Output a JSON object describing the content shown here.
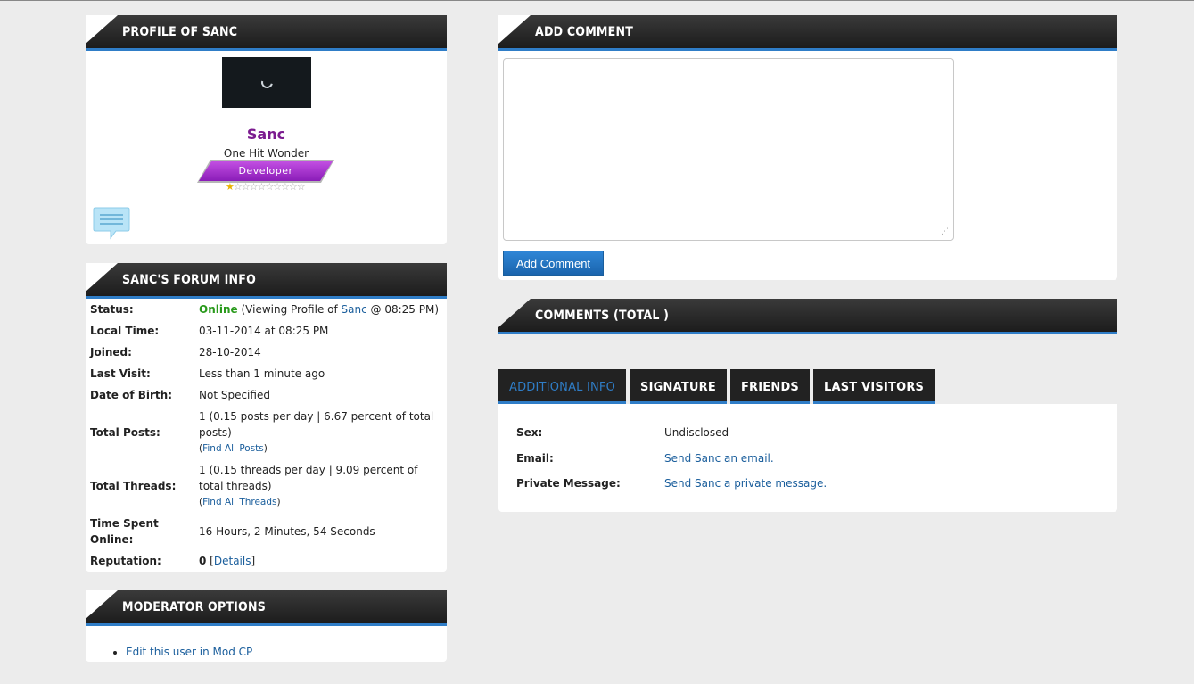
{
  "profile": {
    "header": "PROFILE OF SANC",
    "username": "Sanc",
    "user_title": "One Hit Wonder",
    "rank": "Developer",
    "stars_filled": 1,
    "stars_total": 10
  },
  "forum_info": {
    "header": "SANC'S FORUM INFO",
    "status_label": "Status:",
    "status_value": "Online",
    "status_activity_pre": "(Viewing Profile of ",
    "status_activity_link": "Sanc",
    "status_activity_post": " @ 08:25 PM)",
    "local_time_label": "Local Time:",
    "local_time": "03-11-2014 at 08:25 PM",
    "joined_label": "Joined:",
    "joined": "28-10-2014",
    "last_visit_label": "Last Visit:",
    "last_visit": "Less than 1 minute ago",
    "dob_label": "Date of Birth:",
    "dob": "Not Specified",
    "posts_label": "Total Posts:",
    "posts": "1 (0.15 posts per day | 6.67 percent of total posts)",
    "find_posts": "Find All Posts",
    "threads_label": "Total Threads:",
    "threads": "1 (0.15 threads per day | 9.09 percent of total threads)",
    "find_threads": "Find All Threads",
    "time_online_label": "Time Spent Online:",
    "time_online": "16 Hours, 2 Minutes, 54 Seconds",
    "reputation_label": "Reputation:",
    "reputation": "0",
    "details": "Details"
  },
  "moderator": {
    "header": "MODERATOR OPTIONS",
    "edit_link": "Edit this user in Mod CP"
  },
  "add_comment": {
    "header": "ADD COMMENT",
    "button": "Add Comment"
  },
  "comments": {
    "header": "COMMENTS (TOTAL )"
  },
  "tabs": [
    "ADDITIONAL INFO",
    "SIGNATURE",
    "FRIENDS",
    "LAST VISITORS"
  ],
  "additional_info": {
    "sex_label": "Sex:",
    "sex": "Undisclosed",
    "email_label": "Email:",
    "email_link": "Send Sanc an email.",
    "pm_label": "Private Message:",
    "pm_link": "Send Sanc a private message."
  }
}
